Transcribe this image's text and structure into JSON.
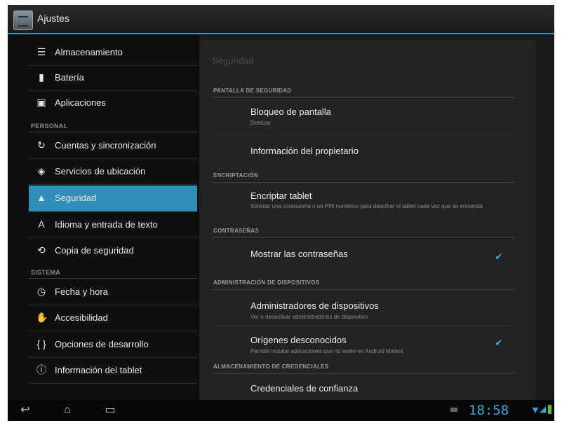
{
  "app": {
    "title": "Ajustes"
  },
  "sidebar": {
    "items": [
      {
        "label": "Almacenamiento",
        "icon": "storage-icon"
      },
      {
        "label": "Batería",
        "icon": "battery-icon"
      },
      {
        "label": "Aplicaciones",
        "icon": "apps-icon"
      },
      {
        "label": "Cuentas y sincronización",
        "icon": "sync-icon"
      },
      {
        "label": "Servicios de ubicación",
        "icon": "location-icon"
      },
      {
        "label": "Seguridad",
        "icon": "lock-icon",
        "selected": true
      },
      {
        "label": "Idioma y entrada de texto",
        "icon": "language-icon"
      },
      {
        "label": "Copia de seguridad",
        "icon": "backup-icon"
      },
      {
        "label": "Fecha y hora",
        "icon": "clock-icon"
      },
      {
        "label": "Accesibilidad",
        "icon": "accessibility-icon"
      },
      {
        "label": "Opciones de desarrollo",
        "icon": "braces-icon"
      },
      {
        "label": "Información del tablet",
        "icon": "info-icon"
      }
    ],
    "headers": {
      "personal": "PERSONAL",
      "sistema": "SISTEMA"
    }
  },
  "detail": {
    "title": "Seguridad",
    "categories": {
      "screen_security": "PANTALLA DE SEGURIDAD",
      "encryption": "ENCRIPTACIÓN",
      "passwords": "CONTRASEÑAS",
      "device_admin": "ADMINISTRACIÓN DE DISPOSITIVOS",
      "credential_storage": "ALMACENAMIENTO DE CREDENCIALES"
    },
    "prefs": {
      "screen_lock": {
        "title": "Bloqueo de pantalla",
        "summary": "Deslizar"
      },
      "owner_info": {
        "title": "Información del propietario"
      },
      "encrypt": {
        "title": "Encriptar tablet",
        "summary": "Solicitar una contraseña o un PIN numérico para descifrar el tablet cada vez que se encienda"
      },
      "show_passwords": {
        "title": "Mostrar las contraseñas",
        "checked": true
      },
      "device_admins": {
        "title": "Administradores de dispositivos",
        "summary": "Ver o desactivar administradores de dispositivo"
      },
      "unknown_sources": {
        "title": "Orígenes desconocidos",
        "summary": "Permitir instalar aplicaciones que no estén en Android Market",
        "checked": true
      },
      "trusted_credentials": {
        "title": "Credenciales de confianza"
      }
    }
  },
  "status": {
    "time": "18:58"
  },
  "colors": {
    "accent": "#2f8fb8",
    "clock": "#36a9d8",
    "check": "#33a8d6"
  }
}
